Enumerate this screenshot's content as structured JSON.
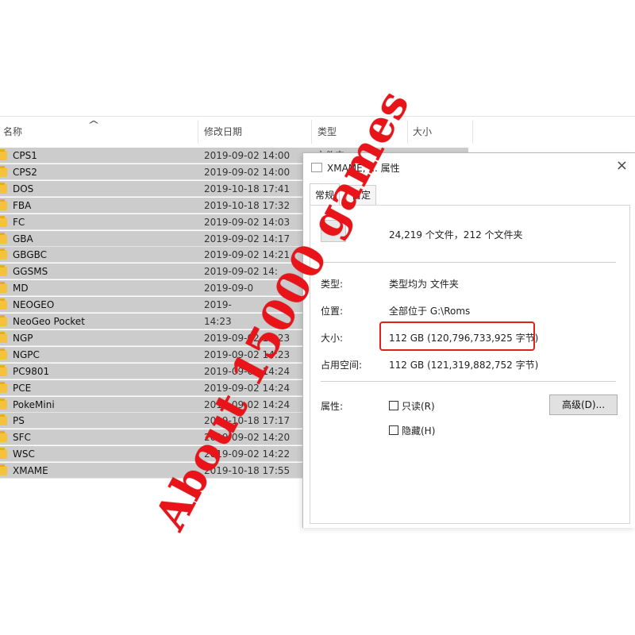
{
  "explorer": {
    "columns": {
      "name": "名称",
      "modified": "修改日期",
      "type": "类型",
      "size": "大小"
    },
    "rows": [
      {
        "name": "CPS1",
        "date": "2019-09-02 14:00",
        "type": "文件夹"
      },
      {
        "name": "CPS2",
        "date": "2019-09-02 14:00",
        "type": ""
      },
      {
        "name": "DOS",
        "date": "2019-10-18 17:41",
        "type": ""
      },
      {
        "name": "FBA",
        "date": "2019-10-18 17:32",
        "type": ""
      },
      {
        "name": "FC",
        "date": "2019-09-02 14:03",
        "type": ""
      },
      {
        "name": "GBA",
        "date": "2019-09-02 14:17",
        "type": ""
      },
      {
        "name": "GBGBC",
        "date": "2019-09-02 14:21",
        "type": ""
      },
      {
        "name": "GGSMS",
        "date": "2019-09-02 14:",
        "type": ""
      },
      {
        "name": "MD",
        "date": "2019-09-0",
        "type": ""
      },
      {
        "name": "NEOGEO",
        "date": "2019-",
        "type": ""
      },
      {
        "name": "NeoGeo Pocket",
        "date": "14:23",
        "type": ""
      },
      {
        "name": "NGP",
        "date": "2019-09-02 14:23",
        "type": ""
      },
      {
        "name": "NGPC",
        "date": "2019-09-02 14:23",
        "type": ""
      },
      {
        "name": "PC9801",
        "date": "2019-09-02 14:24",
        "type": ""
      },
      {
        "name": "PCE",
        "date": "2019-09-02 14:24",
        "type": ""
      },
      {
        "name": "PokeMini",
        "date": "2019-09-02 14:24",
        "type": ""
      },
      {
        "name": "PS",
        "date": "2019-10-18 17:17",
        "type": ""
      },
      {
        "name": "SFC",
        "date": "2019-09-02 14:20",
        "type": ""
      },
      {
        "name": "WSC",
        "date": "2019-09-02 14:22",
        "type": ""
      },
      {
        "name": "XMAME",
        "date": "2019-10-18 17:55",
        "type": ""
      }
    ]
  },
  "dialog": {
    "title": "XMAME, ... 属性",
    "close": "×",
    "tabs": [
      "常规",
      "自定"
    ],
    "summary": "24,219 个文件，212 个文件夹",
    "type_label": "类型:",
    "type_value": "类型均为 文件夹",
    "location_label": "位置:",
    "location_value": "全部位于 G:\\Roms",
    "size_label": "大小:",
    "size_value": "112 GB (120,796,733,925 字节)",
    "disk_label": "占用空间:",
    "disk_value": "112 GB (121,319,882,752 字节)",
    "attr_label": "属性:",
    "readonly_label": "只读(R)",
    "hidden_label": "隐藏(H)",
    "advanced_button": "高级(D)..."
  },
  "overlay": {
    "text": "About 15000 games",
    "color": "#e8141a"
  },
  "colors": {
    "selected_row": "#cccccc",
    "folder": "#f5c23c",
    "highlight_box": "#e0211a"
  }
}
